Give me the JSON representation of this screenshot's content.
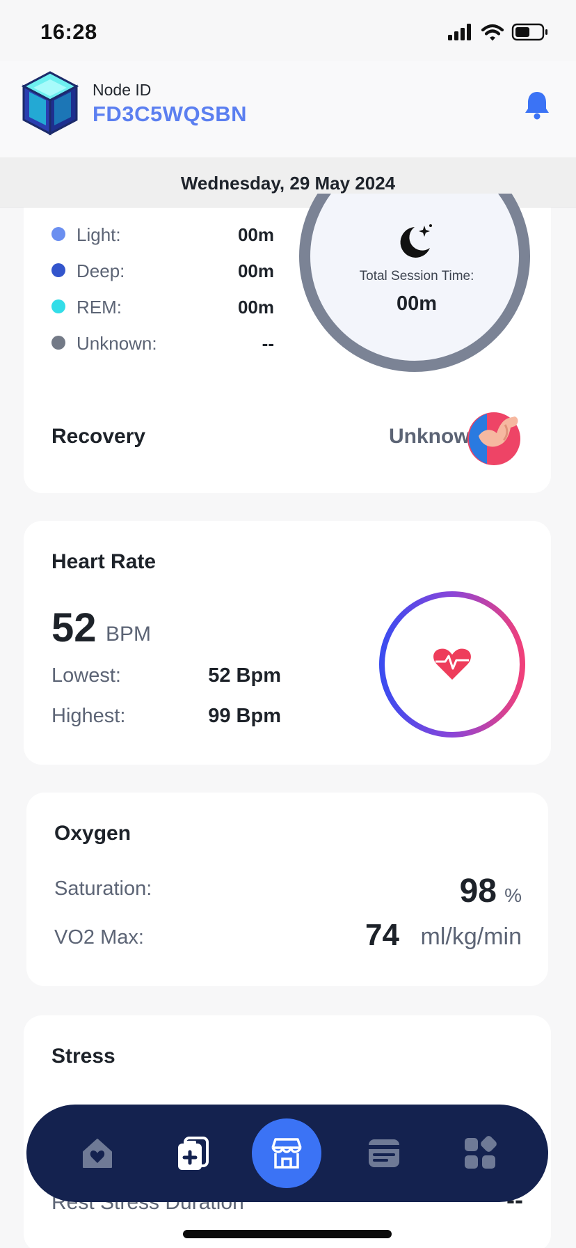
{
  "status_bar": {
    "time": "16:28"
  },
  "header": {
    "node_label": "Node ID",
    "node_id": "FD3C5WQSBN"
  },
  "date": "Wednesday, 29 May 2024",
  "sleep": {
    "stages": [
      {
        "label": "Light:",
        "value": "00m",
        "color": "#6b8ff0"
      },
      {
        "label": "Deep:",
        "value": "00m",
        "color": "#3355cc"
      },
      {
        "label": "REM:",
        "value": "00m",
        "color": "#33dde8"
      },
      {
        "label": "Unknown:",
        "value": "--",
        "color": "#737a87"
      }
    ],
    "session_label": "Total Session Time:",
    "session_value": "00m",
    "recovery_label": "Recovery",
    "recovery_value": "Unknown"
  },
  "heart_rate": {
    "title": "Heart Rate",
    "value": "52",
    "unit": "BPM",
    "lowest_label": "Lowest:",
    "lowest_value": "52 Bpm",
    "highest_label": "Highest:",
    "highest_value": "99 Bpm"
  },
  "oxygen": {
    "title": "Oxygen",
    "saturation_label": "Saturation:",
    "saturation_value": "98",
    "saturation_unit": "%",
    "vo2_label": "VO2 Max:",
    "vo2_value": "74",
    "vo2_unit": "ml/kg/min"
  },
  "stress": {
    "title": "Stress",
    "rest_label": "Rest Stress Duration",
    "rest_value": "--"
  },
  "nav": {
    "items": [
      {
        "icon": "home-icon"
      },
      {
        "icon": "health-icon"
      },
      {
        "icon": "store-icon",
        "active": true
      },
      {
        "icon": "card-icon"
      },
      {
        "icon": "apps-icon"
      }
    ],
    "bg_color": "#14224f",
    "active_color": "#3b73f5"
  }
}
